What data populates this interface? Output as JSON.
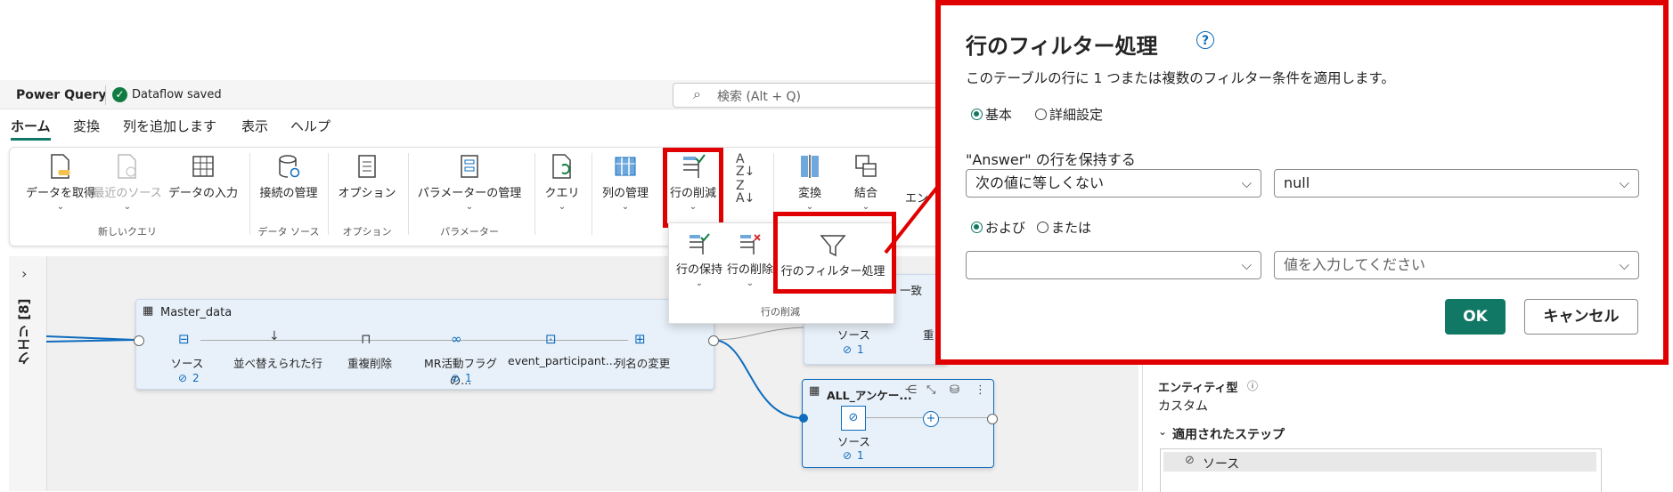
{
  "header": {
    "app_title": "Power Query",
    "status": "Dataflow saved",
    "search_placeholder": "検索 (Alt + Q)"
  },
  "tabs": [
    "ホーム",
    "変換",
    "列を追加します",
    "表示",
    "ヘルプ"
  ],
  "ribbon": {
    "buttons": {
      "get_data": "データを取得",
      "recent": "最近のソース",
      "enter_data": "データの入力",
      "manage_conn": "接続の管理",
      "options": "オプション",
      "manage_params": "パラメーターの管理",
      "query": "クエリ",
      "manage_cols": "列の管理",
      "reduce_rows": "行の削減",
      "transform": "変換",
      "combine": "結合",
      "entity_trunc": "エン"
    },
    "groups": {
      "new_query": "新しいクエリ",
      "data_source": "データ ソース",
      "options": "オプション",
      "parameters": "パラメーター"
    }
  },
  "dropdown": {
    "keep_rows": "行の保持",
    "remove_rows": "行の削除",
    "filter_rows": "行のフィルター処理",
    "group_label": "行の削減"
  },
  "left_panel": {
    "label": "クエリ [8]"
  },
  "master_node": {
    "title": "Master_data",
    "steps": [
      "ソース",
      "並べ替えられた行",
      "重複削除",
      "MR活動フラグの...",
      "event_participant...",
      "列名の変更"
    ],
    "link_counts": [
      "2",
      "1"
    ]
  },
  "top_node": {
    "title_fragment": "一致",
    "step": "ソース",
    "step_fragment": "重",
    "count": "1"
  },
  "all_node": {
    "title": "ALL_アンケー...",
    "step": "ソース",
    "count": "1"
  },
  "right_panel": {
    "entity_type_label": "エンティティ型",
    "entity_type_value": "カスタム",
    "applied_steps_label": "適用されたステップ",
    "step_item": "ソース"
  },
  "dialog": {
    "title": "行のフィルター処理",
    "help_icon": "?",
    "description": "このテーブルの行に 1 つまたは複数のフィルター条件を適用します。",
    "mode_basic": "基本",
    "mode_advanced": "詳細設定",
    "keep_label": "\"Answer\" の行を保持する",
    "op1": "次の値に等しくない",
    "val1": "null",
    "and_label": "および",
    "or_label": "または",
    "op2": "",
    "val2_placeholder": "値を入力してください",
    "ok": "OK",
    "cancel": "キャンセル"
  },
  "colors": {
    "accent": "#117865",
    "highlight": "#e00000",
    "link": "#0f6cbd"
  }
}
